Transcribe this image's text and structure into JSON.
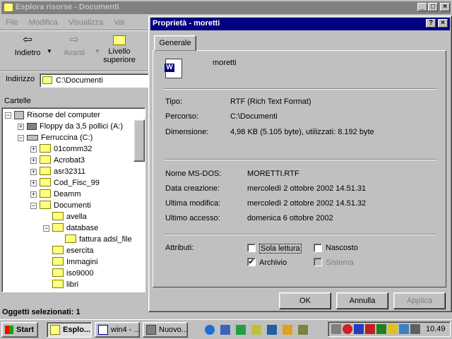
{
  "explorer": {
    "title": "Esplora risorse - Documenti",
    "menu": [
      "File",
      "Modifica",
      "Visualizza",
      "Vai"
    ],
    "toolbar": {
      "back": "Indietro",
      "forward": "Avanti",
      "up_line1": "Livello",
      "up_line2": "superiore"
    },
    "address_label": "Indirizzo",
    "address_value": "C:\\Documenti",
    "pane_title": "Cartelle",
    "status": "Oggetti selezionati: 1",
    "tree": [
      {
        "label": "Risorse del computer"
      },
      {
        "label": "Floppy da 3,5 pollici (A:)"
      },
      {
        "label": "Ferruccina (C:)"
      },
      {
        "label": "01comm32"
      },
      {
        "label": "Acrobat3"
      },
      {
        "label": "asr32311"
      },
      {
        "label": "Cod_Fisc_99"
      },
      {
        "label": "Deamm"
      },
      {
        "label": "Documenti"
      },
      {
        "label": "avella"
      },
      {
        "label": "database"
      },
      {
        "label": "fattura adsl_file"
      },
      {
        "label": "esercita"
      },
      {
        "label": "Immagini"
      },
      {
        "label": "iso9000"
      },
      {
        "label": "libri"
      }
    ]
  },
  "dialog": {
    "title": "Proprietà - moretti",
    "tab": "Generale",
    "filename": "moretti",
    "rows1": [
      {
        "label": "Tipo:",
        "value": "RTF (Rich Text Format)"
      },
      {
        "label": "Percorso:",
        "value": "C:\\Documenti"
      },
      {
        "label": "Dimensione:",
        "value": "4,98 KB (5.105 byte), utilizzati: 8.192 byte"
      }
    ],
    "rows2": [
      {
        "label": "Nome MS-DOS:",
        "value": "MORETTI.RTF"
      },
      {
        "label": "Data creazione:",
        "value": "mercoledì 2 ottobre 2002 14.51.31"
      },
      {
        "label": "Ultima modifica:",
        "value": "mercoledì 2 ottobre 2002 14.51.32"
      },
      {
        "label": "Ultimo accesso:",
        "value": "domenica 6 ottobre 2002"
      }
    ],
    "attributes_label": "Attributi:",
    "attr_readonly": "Sola lettura",
    "attr_hidden": "Nascosto",
    "attr_archive": "Archivio",
    "attr_system": "Sistema",
    "ok": "OK",
    "cancel": "Annulla",
    "apply": "Applica"
  },
  "taskbar": {
    "start": "Start",
    "tasks": [
      "Esplo...",
      "win4 - ...",
      "Nuovo..."
    ],
    "clock": "10.49"
  }
}
